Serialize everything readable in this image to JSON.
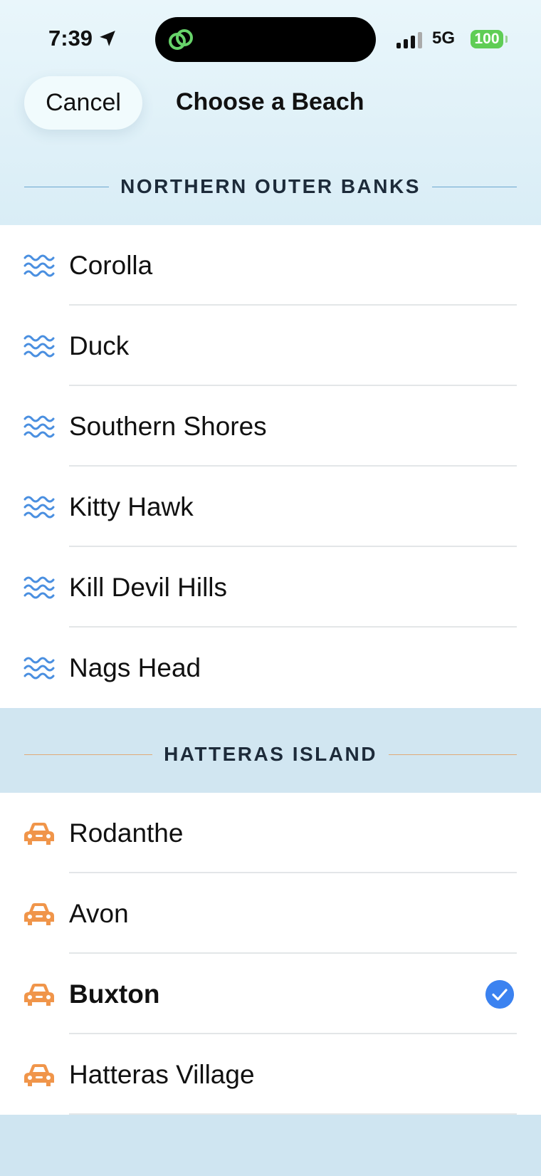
{
  "status_bar": {
    "time": "7:39",
    "network": "5G",
    "battery": "100"
  },
  "header": {
    "cancel_label": "Cancel",
    "title": "Choose a Beach"
  },
  "sections": [
    {
      "title": "NORTHERN OUTER BANKS",
      "icon": "waves-icon",
      "items": [
        {
          "name": "Corolla"
        },
        {
          "name": "Duck"
        },
        {
          "name": "Southern Shores"
        },
        {
          "name": "Kitty Hawk"
        },
        {
          "name": "Kill Devil Hills"
        },
        {
          "name": "Nags Head"
        }
      ]
    },
    {
      "title": "HATTERAS ISLAND",
      "icon": "car-icon",
      "items": [
        {
          "name": "Rodanthe"
        },
        {
          "name": "Avon"
        },
        {
          "name": "Buxton",
          "selected": true
        },
        {
          "name": "Hatteras Village"
        }
      ]
    }
  ],
  "colors": {
    "wave_icon": "#4a8fe0",
    "car_icon": "#f0954a",
    "check": "#3b82f0"
  }
}
